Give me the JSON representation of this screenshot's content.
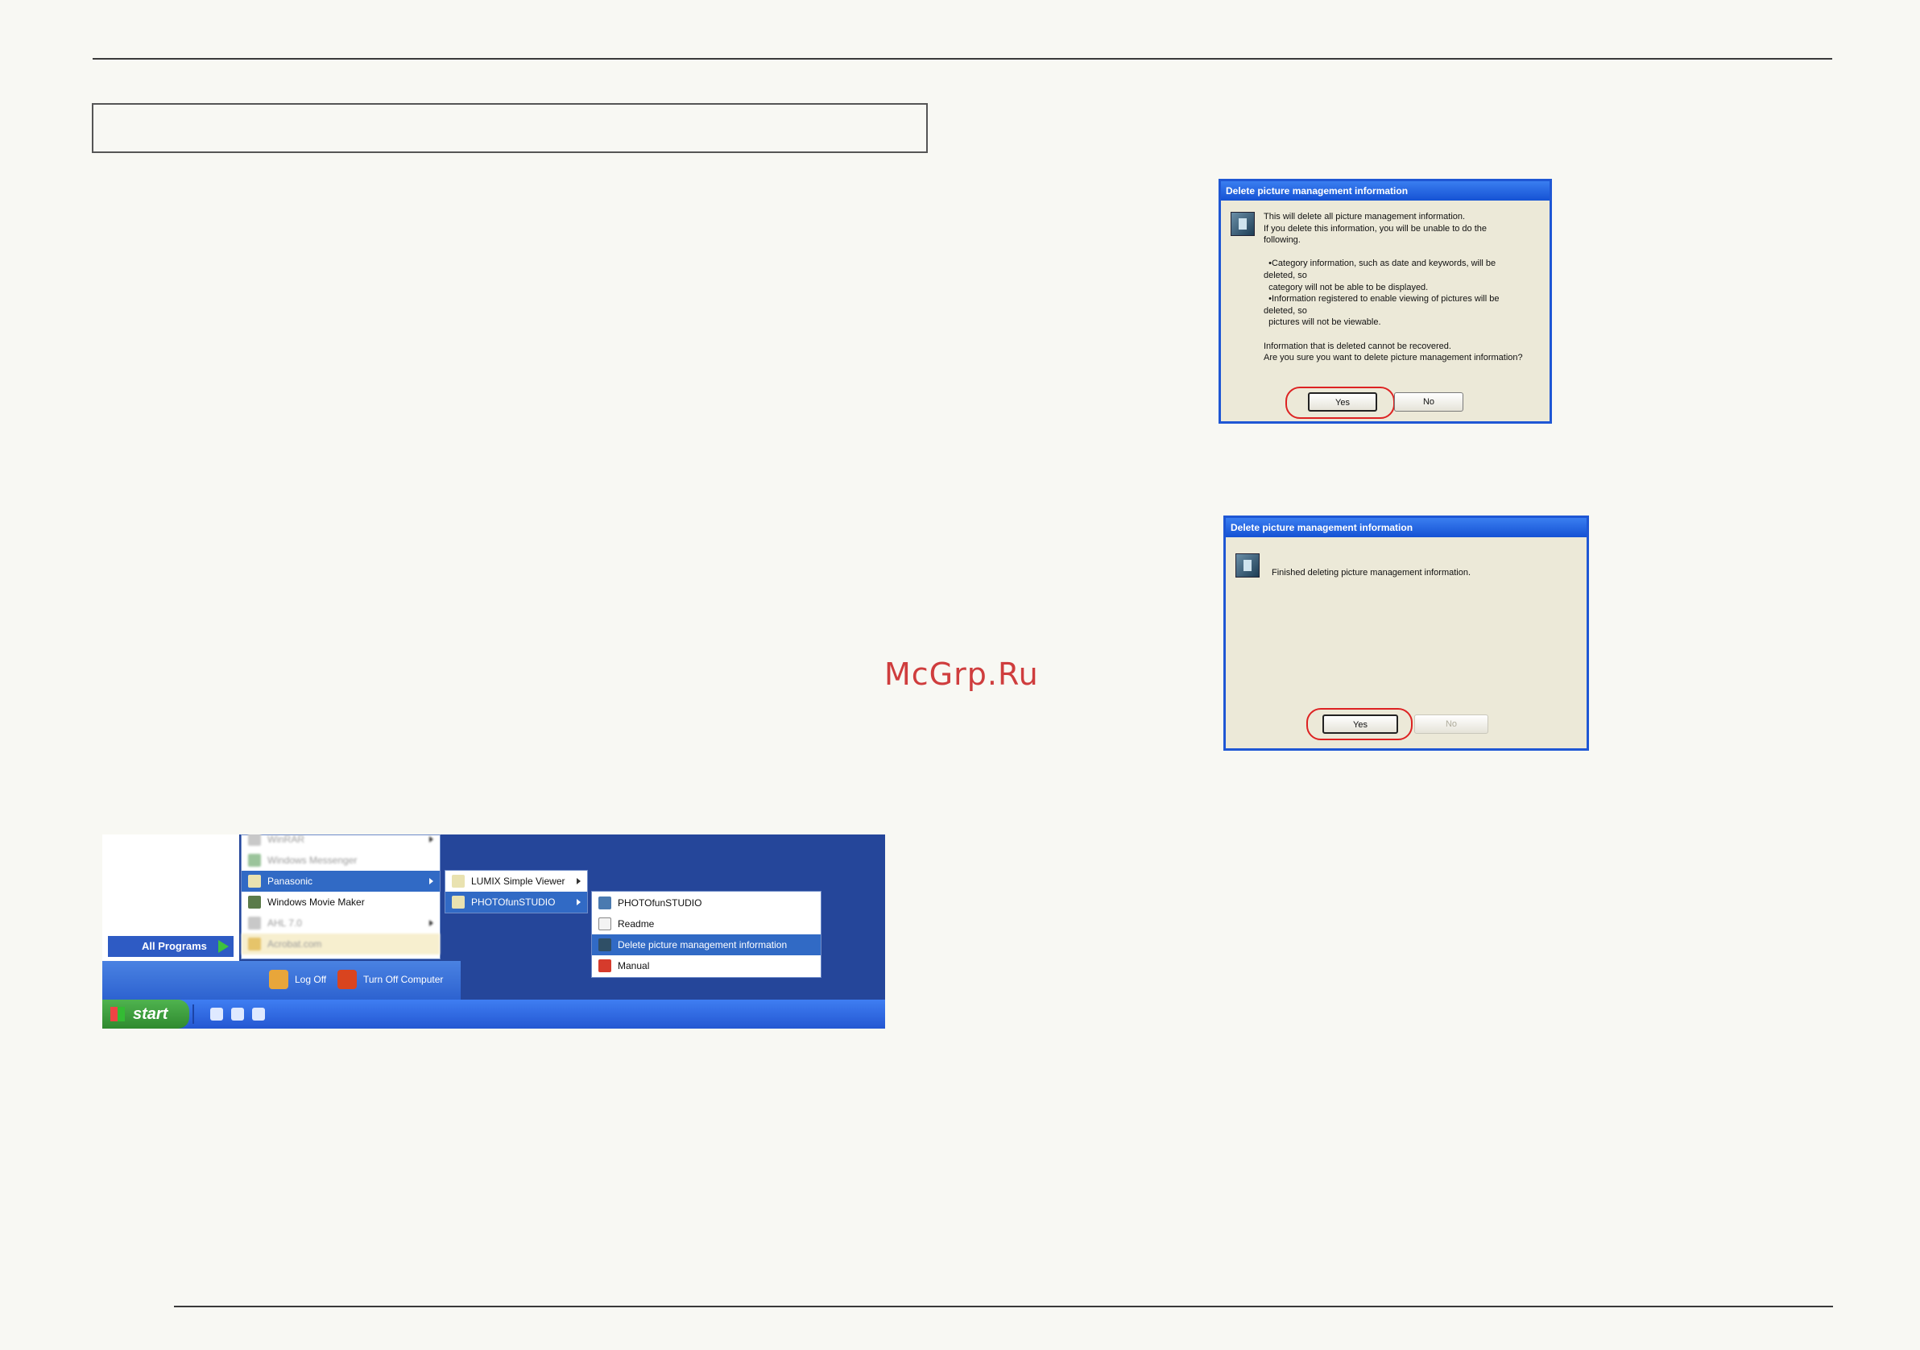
{
  "watermark": "McGrp.Ru",
  "dialog1": {
    "title": "Delete picture management information",
    "message": "This will delete all picture management information.\nIf you delete this information, you will be unable to do the\nfollowing.\n\n  •Category information, such as date and keywords, will be\ndeleted, so\n  category will not be able to be displayed.\n  •Information registered to enable viewing of pictures will be\ndeleted, so\n  pictures will not be viewable.\n\nInformation that is deleted cannot be recovered.\nAre you sure you want to delete picture management information?",
    "yes_label": "Yes",
    "no_label": "No"
  },
  "dialog2": {
    "title": "Delete picture management information",
    "message": "Finished deleting picture management information.",
    "yes_label": "Yes",
    "no_label": "No"
  },
  "start_menu": {
    "all_programs_label": "All Programs",
    "log_off_label": "Log Off",
    "turn_off_label": "Turn Off Computer",
    "start_label": "start",
    "programs": [
      {
        "label": "WinRAR",
        "blurred": true,
        "submenu": true
      },
      {
        "label": "Windows Messenger",
        "blurred": true,
        "submenu": false
      },
      {
        "label": "Panasonic",
        "blurred": false,
        "submenu": true,
        "selected": true
      },
      {
        "label": "Windows Movie Maker",
        "blurred": false,
        "submenu": false
      },
      {
        "label": "AHL 7.0",
        "blurred": true,
        "submenu": true
      },
      {
        "label": "Acrobat.com",
        "blurred": true,
        "submenu": false
      }
    ],
    "panasonic_submenu": [
      {
        "label": "LUMIX Simple Viewer",
        "submenu": true
      },
      {
        "label": "PHOTOfunSTUDIO",
        "submenu": true,
        "selected": true
      }
    ],
    "photofunstudio_submenu": [
      {
        "label": "PHOTOfunSTUDIO"
      },
      {
        "label": "Readme"
      },
      {
        "label": "Delete picture management information",
        "selected": true
      },
      {
        "label": "Manual"
      }
    ]
  },
  "colors": {
    "title_bar": "#1f57d4",
    "dialog_bg": "#ece9d8",
    "highlight_ring": "#dd2222",
    "menu_selection": "#316ac5",
    "watermark": "#cf3d3d"
  }
}
